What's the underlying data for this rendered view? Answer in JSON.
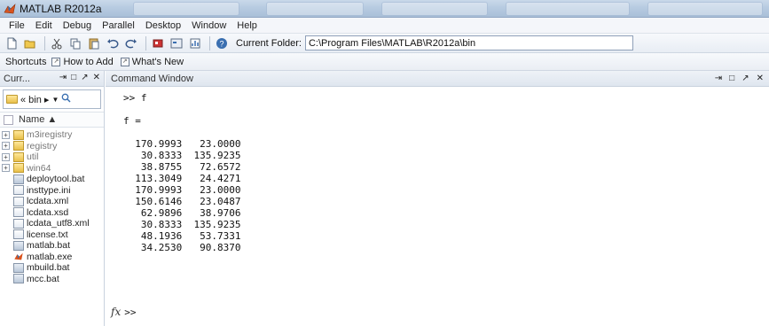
{
  "window": {
    "title": "MATLAB  R2012a"
  },
  "menu": [
    "File",
    "Edit",
    "Debug",
    "Parallel",
    "Desktop",
    "Window",
    "Help"
  ],
  "toolbar": {
    "current_folder_label": "Current Folder:",
    "current_folder_value": "C:\\Program Files\\MATLAB\\R2012a\\bin",
    "icons": [
      "new-file-icon",
      "open-icon",
      "cut-icon",
      "copy-icon",
      "paste-icon",
      "undo-icon",
      "redo-icon",
      "simulink-icon",
      "guide-icon",
      "profiler-icon",
      "help-icon"
    ]
  },
  "shortcuts": {
    "label": "Shortcuts",
    "items": [
      "How to Add",
      "What's New"
    ]
  },
  "left_panel": {
    "header": "Curr...",
    "nav_path": "« bin ▸",
    "name_column": "Name ▲",
    "files": [
      {
        "name": "m3iregistry",
        "type": "folder",
        "expander": "+",
        "dim": true
      },
      {
        "name": "registry",
        "type": "folder",
        "expander": "+",
        "dim": true
      },
      {
        "name": "util",
        "type": "folder",
        "expander": "+",
        "dim": true
      },
      {
        "name": "win64",
        "type": "folder",
        "expander": "+",
        "dim": true
      },
      {
        "name": "deploytool.bat",
        "type": "bat"
      },
      {
        "name": "insttype.ini",
        "type": "file"
      },
      {
        "name": "lcdata.xml",
        "type": "file"
      },
      {
        "name": "lcdata.xsd",
        "type": "file"
      },
      {
        "name": "lcdata_utf8.xml",
        "type": "file"
      },
      {
        "name": "license.txt",
        "type": "file"
      },
      {
        "name": "matlab.bat",
        "type": "bat"
      },
      {
        "name": "matlab.exe",
        "type": "matlab"
      },
      {
        "name": "mbuild.bat",
        "type": "bat"
      },
      {
        "name": "mcc.bat",
        "type": "bat"
      }
    ]
  },
  "command_window": {
    "title": "Command Window",
    "lines": [
      ">> f",
      "",
      "f =",
      "",
      "  170.9993   23.0000",
      "   30.8333  135.9235",
      "   38.8755   72.6572",
      "  113.3049   24.4271",
      "  170.9993   23.0000",
      "  150.6146   23.0487",
      "   62.9896   38.9706",
      "   30.8333  135.9235",
      "   48.1936   53.7331",
      "   34.2530   90.8370"
    ],
    "prompt_fx": "fx",
    "prompt": ">>"
  }
}
